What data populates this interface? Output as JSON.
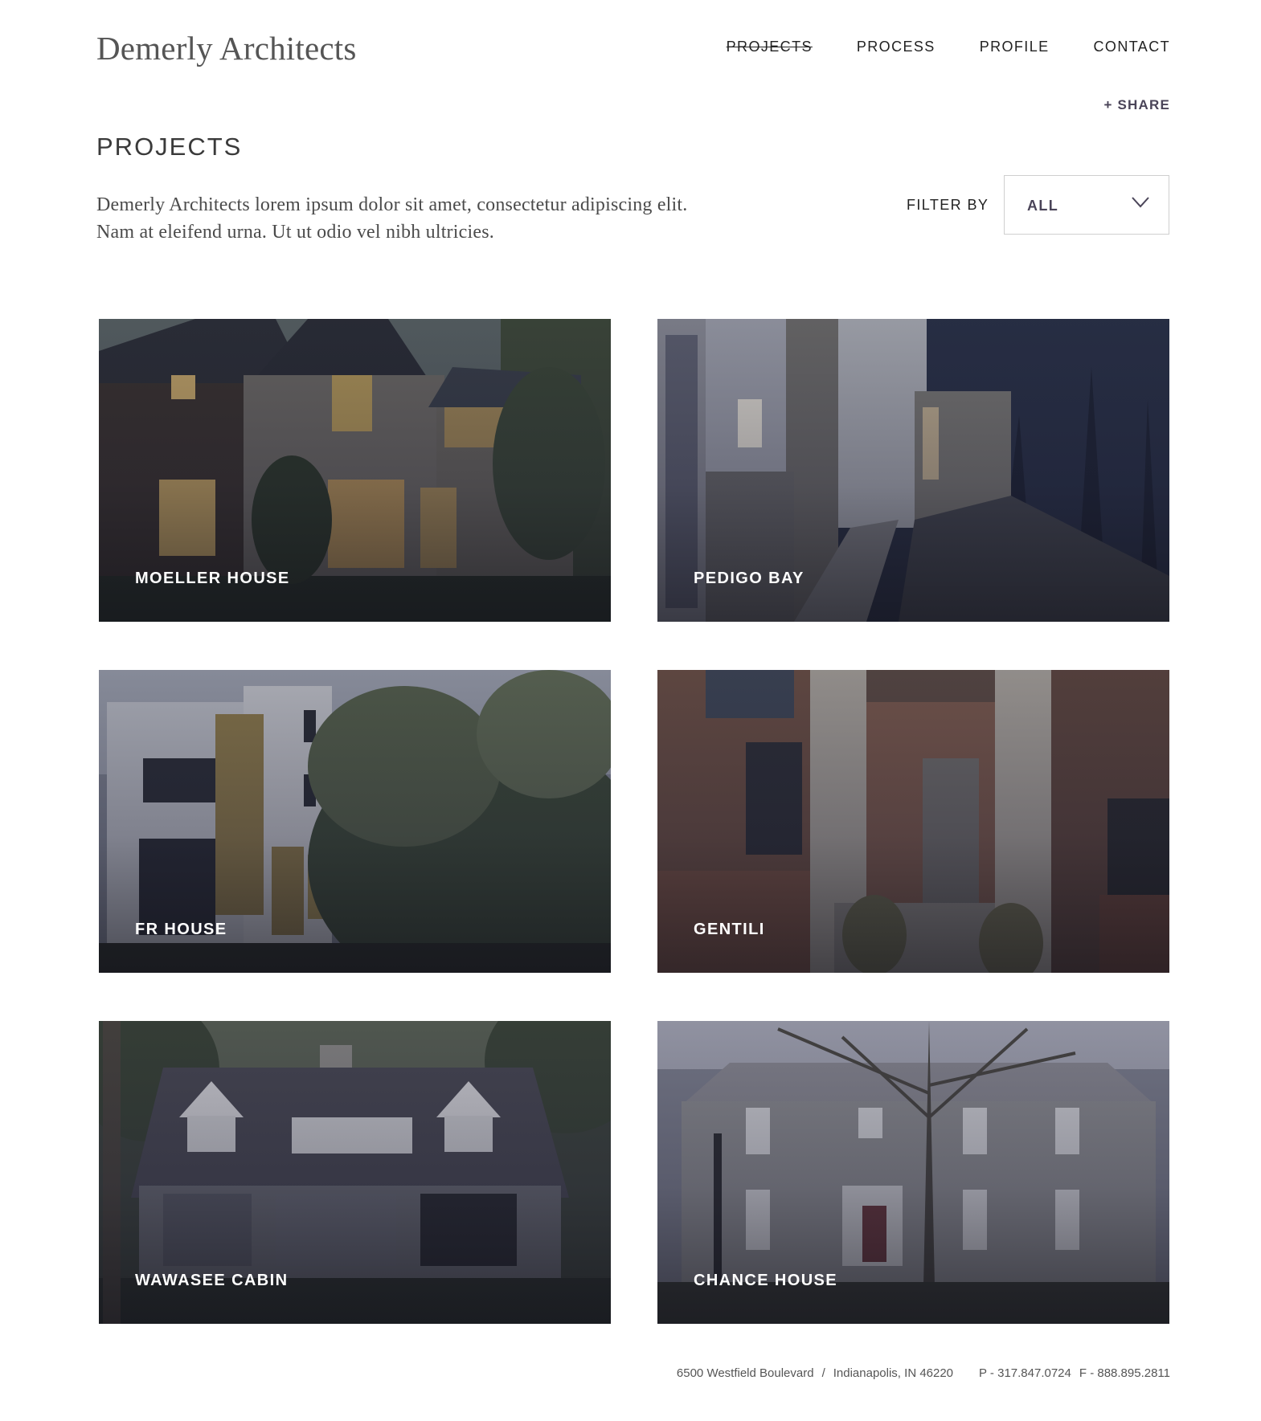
{
  "logo": "Demerly Architects",
  "nav": {
    "projects": "PROJECTS",
    "process": "PROCESS",
    "profile": "PROFILE",
    "contact": "CONTACT"
  },
  "share": "+ SHARE",
  "page_title": "PROJECTS",
  "intro": "Demerly Architects lorem ipsum dolor sit amet, consectetur adipiscing elit. Nam at eleifend urna. Ut ut odio vel nibh ultricies.",
  "filter": {
    "label": "FILTER BY",
    "value": "ALL"
  },
  "projects": [
    {
      "title": "MOELLER HOUSE"
    },
    {
      "title": "PEDIGO BAY"
    },
    {
      "title": "FR HOUSE"
    },
    {
      "title": "GENTILI"
    },
    {
      "title": "WAWASEE CABIN"
    },
    {
      "title": "CHANCE HOUSE"
    }
  ],
  "footer": {
    "street": "6500 Westfield Boulevard",
    "separator": "/",
    "city": "Indianapolis, IN 46220",
    "phone": "P - 317.847.0724",
    "fax": "F - 888.895.2811"
  },
  "colors": {
    "accent": "#4a4458",
    "text": "#222222",
    "card_overlay": "#141428"
  }
}
